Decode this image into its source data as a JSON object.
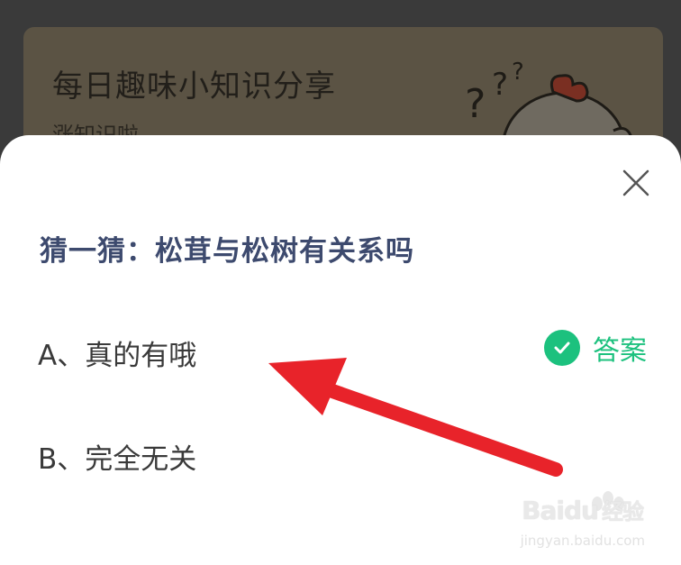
{
  "background_card": {
    "title": "每日趣味小知识分享",
    "subtitle": "涨知识啦"
  },
  "quiz": {
    "question": "猜一猜：松茸与松树有关系吗",
    "options": [
      {
        "label": "A、真的有哦",
        "correct": true
      },
      {
        "label": "B、完全无关",
        "correct": false
      }
    ],
    "answer_label": "答案"
  },
  "watermark": {
    "brand_latin": "Bai",
    "brand_du": "du",
    "brand_cn": "经验",
    "url": "jingyan.baidu.com"
  },
  "colors": {
    "accent_green": "#1cc17e",
    "question_text": "#3d4a6e",
    "annotation_arrow": "#e8232a"
  },
  "icons": [
    "close-icon",
    "check-icon",
    "mascot-chicken-icon",
    "baidu-paw-icon"
  ]
}
